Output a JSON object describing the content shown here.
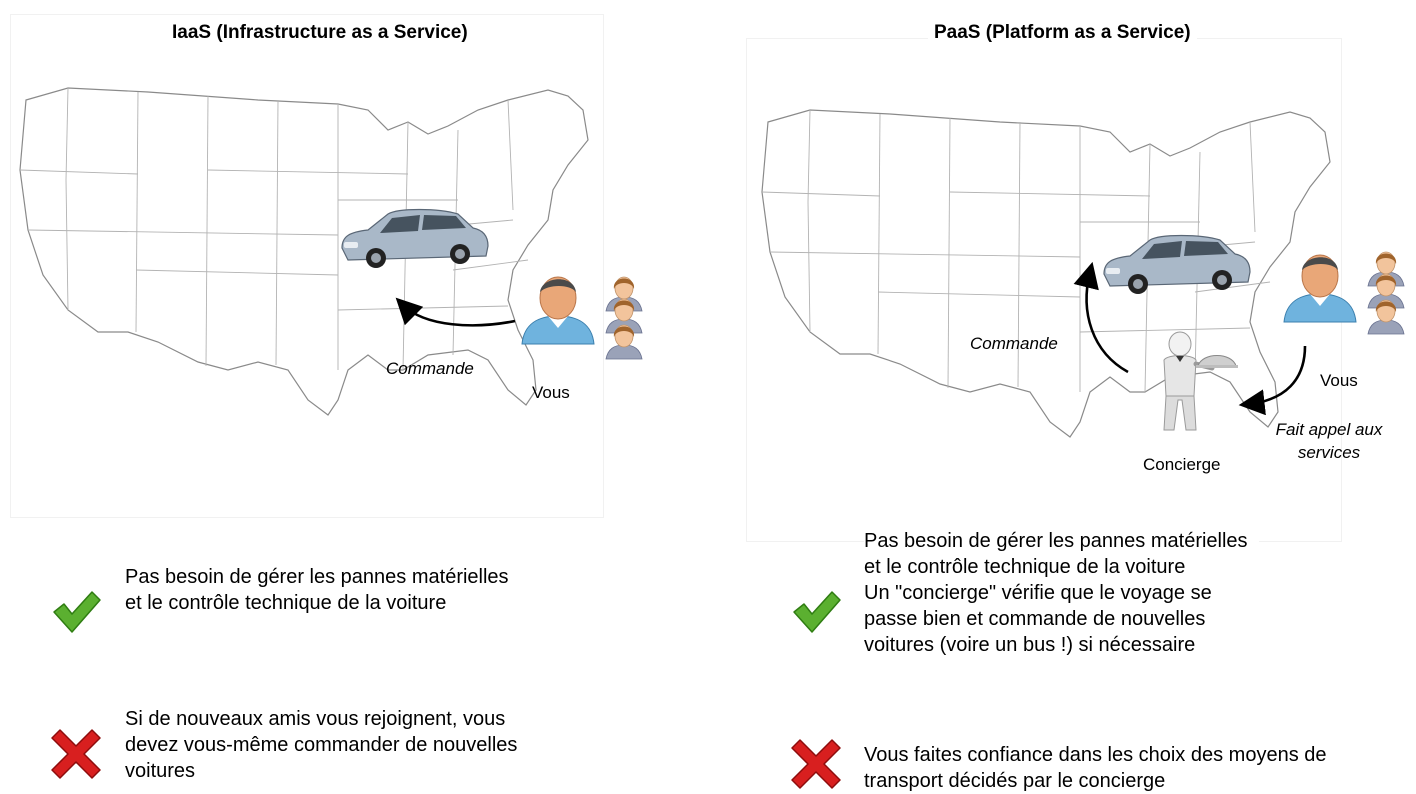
{
  "left": {
    "title": "IaaS (Infrastructure as a Service)",
    "labels": {
      "commande": "Commande",
      "vous": "Vous"
    },
    "pro": "Pas besoin de gérer les pannes matérielles et le contrôle technique de la voiture",
    "con": "Si de nouveaux amis vous rejoignent, vous devez vous-même commander de nouvelles voitures"
  },
  "right": {
    "title": "PaaS (Platform as a Service)",
    "labels": {
      "commande": "Commande",
      "vous": "Vous",
      "fait_appel": "Fait appel aux services",
      "concierge": "Concierge"
    },
    "pro": "Pas besoin de gérer les pannes matérielles et le contrôle technique de la voiture\nUn \"concierge\" vérifie que le voyage se passe bien et commande de nouvelles voitures (voire un bus !) si nécessaire",
    "con": "Vous faites confiance dans les choix des moyens de transport décidés par le concierge"
  },
  "icons": {
    "map": "us-map-outline",
    "car": "car-icon",
    "user": "user-icon",
    "friends": "friends-icon",
    "concierge": "concierge-icon",
    "check": "check-icon",
    "cross": "cross-icon"
  },
  "colors": {
    "check": "#5bb030",
    "cross": "#d81f1f",
    "car": "#a9b8c8",
    "shirt": "#6fb3de"
  }
}
